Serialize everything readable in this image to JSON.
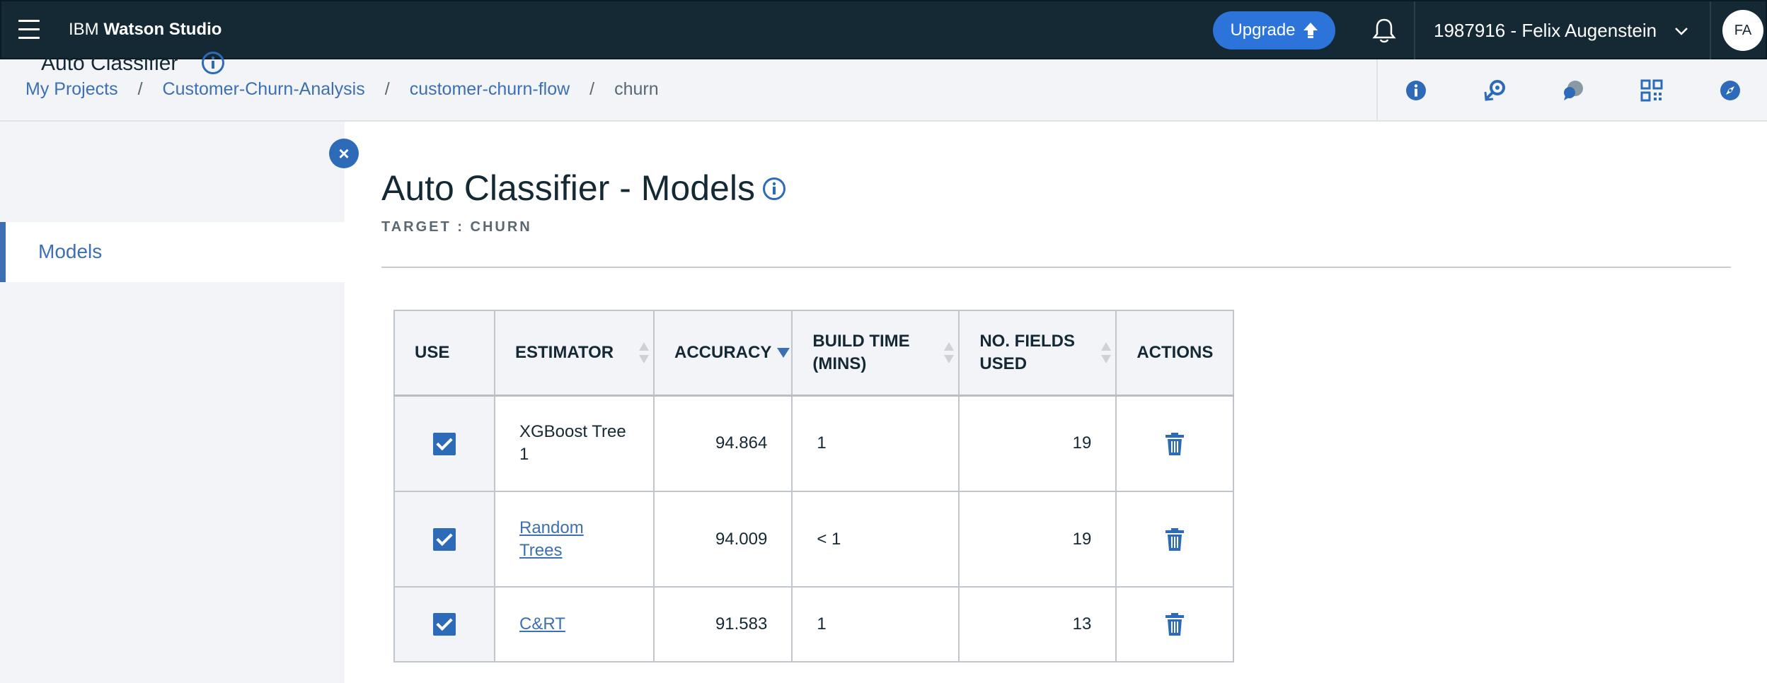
{
  "topbar": {
    "brand_prefix": "IBM ",
    "brand_name": "Watson Studio",
    "upgrade_label": "Upgrade",
    "account_label": "1987916 - Felix Augenstein",
    "avatar_initials": "FA"
  },
  "breadcrumb": {
    "items": [
      {
        "label": "My Projects"
      },
      {
        "label": "Customer-Churn-Analysis"
      },
      {
        "label": "customer-churn-flow"
      }
    ],
    "separator": "/",
    "current": "churn"
  },
  "toolbar_icons": [
    "info-icon",
    "search-history-icon",
    "chat-icon",
    "grid-icon",
    "compass-icon"
  ],
  "sidebar": {
    "title": "Auto Classifier",
    "items": [
      {
        "label": "Models",
        "active": true
      }
    ],
    "close_glyph": "×"
  },
  "main": {
    "title": "Auto Classifier - Models",
    "subtitle": "TARGET : CHURN"
  },
  "table": {
    "headers": {
      "use": "USE",
      "estimator": "ESTIMATOR",
      "accuracy": "ACCURACY",
      "build_time_1": "BUILD TIME",
      "build_time_2": "(MINS)",
      "fields_1": "NO. FIELDS",
      "fields_2": "USED",
      "actions": "ACTIONS"
    },
    "sort": {
      "column": "accuracy",
      "direction": "descending"
    },
    "rows": [
      {
        "use": true,
        "estimator_1": "XGBoost Tree",
        "estimator_2": "1",
        "estimator_link": false,
        "accuracy": "94.864",
        "build_time": "1",
        "fields_used": "19"
      },
      {
        "use": true,
        "estimator_1": "Random",
        "estimator_2": "Trees",
        "estimator_link": true,
        "accuracy": "94.009",
        "build_time": "< 1",
        "fields_used": "19"
      },
      {
        "use": true,
        "estimator_1": "C&RT",
        "estimator_2": "",
        "estimator_link": true,
        "accuracy": "91.583",
        "build_time": "1",
        "fields_used": "13"
      }
    ]
  },
  "colors": {
    "topbar_bg": "#152935",
    "accent": "#3d70b2",
    "upgrade_bg": "#2d74da",
    "panel_bg": "#f2f4f8"
  }
}
